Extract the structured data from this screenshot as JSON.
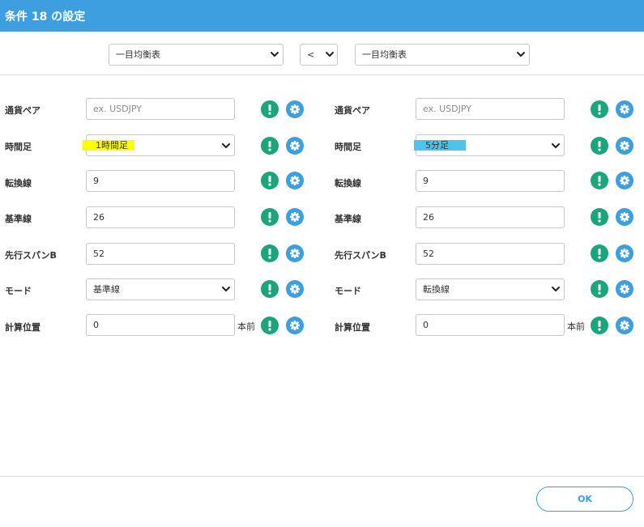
{
  "dialog": {
    "title": "条件 18 の設定"
  },
  "top_selects": {
    "left_indicator": "一目均衡表",
    "operator": "<",
    "right_indicator": "一目均衡表"
  },
  "left": {
    "pair_label": "通貨ペア",
    "pair_placeholder": "ex. USDJPY",
    "timeframe_label": "時間足",
    "timeframe_value": "1時間足",
    "timeframe_highlight": "#ffff00",
    "conversion_label": "転換線",
    "conversion_value": "9",
    "base_label": "基準線",
    "base_value": "26",
    "span_label": "先行スパンB",
    "span_value": "52",
    "mode_label": "モード",
    "mode_value": "基準線",
    "position_label": "計算位置",
    "position_value": "0",
    "position_unit": "本前"
  },
  "right": {
    "pair_label": "通貨ペア",
    "pair_placeholder": "ex. USDJPY",
    "timeframe_label": "時間足",
    "timeframe_value": "5分足",
    "timeframe_highlight": "#4ec3ee",
    "conversion_label": "転換線",
    "conversion_value": "9",
    "base_label": "基準線",
    "base_value": "26",
    "span_label": "先行スパンB",
    "span_value": "52",
    "mode_label": "モード",
    "mode_value": "転換線",
    "position_label": "計算位置",
    "position_value": "0",
    "position_unit": "本前"
  },
  "footer": {
    "ok_label": "OK"
  },
  "colors": {
    "header": "#3d9ee0",
    "info_button": "#1ba57a",
    "settings_button": "#3d9ee0"
  },
  "icons": {
    "info": "exclamation-icon",
    "settings": "gear-icon",
    "dropdown": "chevron-down-icon"
  }
}
